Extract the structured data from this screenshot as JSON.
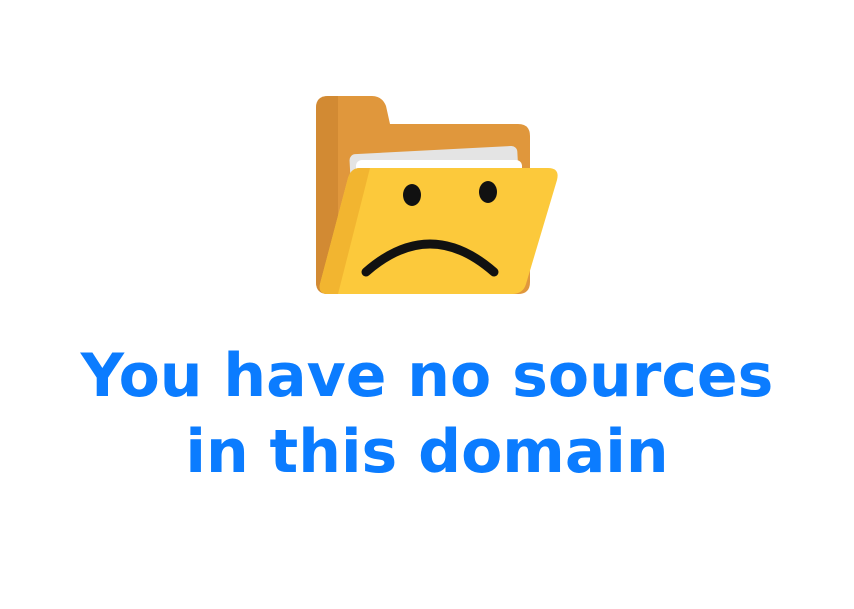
{
  "empty_state": {
    "icon": "sad-folder-icon",
    "message_lines": [
      "You have no sources",
      "in this domain"
    ]
  },
  "colors": {
    "message_text": "#0b7cff",
    "folder_back": "#e0973c",
    "folder_back_shadow": "#d28a33",
    "folder_front": "#fcc93b",
    "folder_front_shadow": "#f2b530",
    "paper": "#ffffff",
    "paper_shadow": "#e4e4e4",
    "face": "#111111"
  }
}
